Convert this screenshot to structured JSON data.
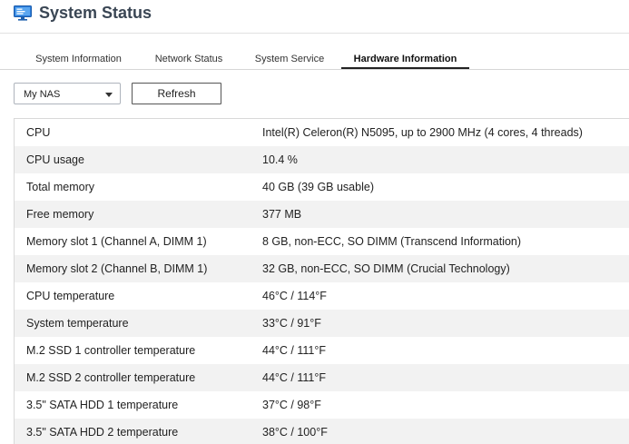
{
  "header": {
    "title": "System Status",
    "icon": "monitor-icon",
    "icon_color": "#2b7bd8"
  },
  "tabs": [
    {
      "label": "System Information",
      "active": false
    },
    {
      "label": "Network Status",
      "active": false
    },
    {
      "label": "System Service",
      "active": false
    },
    {
      "label": "Hardware Information",
      "active": true
    }
  ],
  "toolbar": {
    "device_select_value": "My NAS",
    "refresh_label": "Refresh"
  },
  "hardware": [
    {
      "label": "CPU",
      "value": "Intel(R) Celeron(R) N5095, up to 2900 MHz (4 cores, 4 threads)"
    },
    {
      "label": "CPU usage",
      "value": "10.4 %"
    },
    {
      "label": "Total memory",
      "value": "40 GB (39 GB usable)"
    },
    {
      "label": "Free memory",
      "value": "377 MB"
    },
    {
      "label": "Memory slot 1 (Channel A, DIMM 1)",
      "value": "8 GB, non-ECC, SO DIMM (Transcend Information)"
    },
    {
      "label": "Memory slot 2 (Channel B, DIMM 1)",
      "value": "32 GB, non-ECC, SO DIMM (Crucial Technology)"
    },
    {
      "label": "CPU temperature",
      "value": "46°C / 114°F"
    },
    {
      "label": "System temperature",
      "value": "33°C / 91°F"
    },
    {
      "label": "M.2 SSD 1 controller temperature",
      "value": "44°C / 111°F"
    },
    {
      "label": "M.2 SSD 2 controller temperature",
      "value": "44°C / 111°F"
    },
    {
      "label": "3.5\" SATA HDD 1 temperature",
      "value": "37°C / 98°F"
    },
    {
      "label": "3.5\" SATA HDD 2 temperature",
      "value": "38°C / 100°F"
    }
  ]
}
